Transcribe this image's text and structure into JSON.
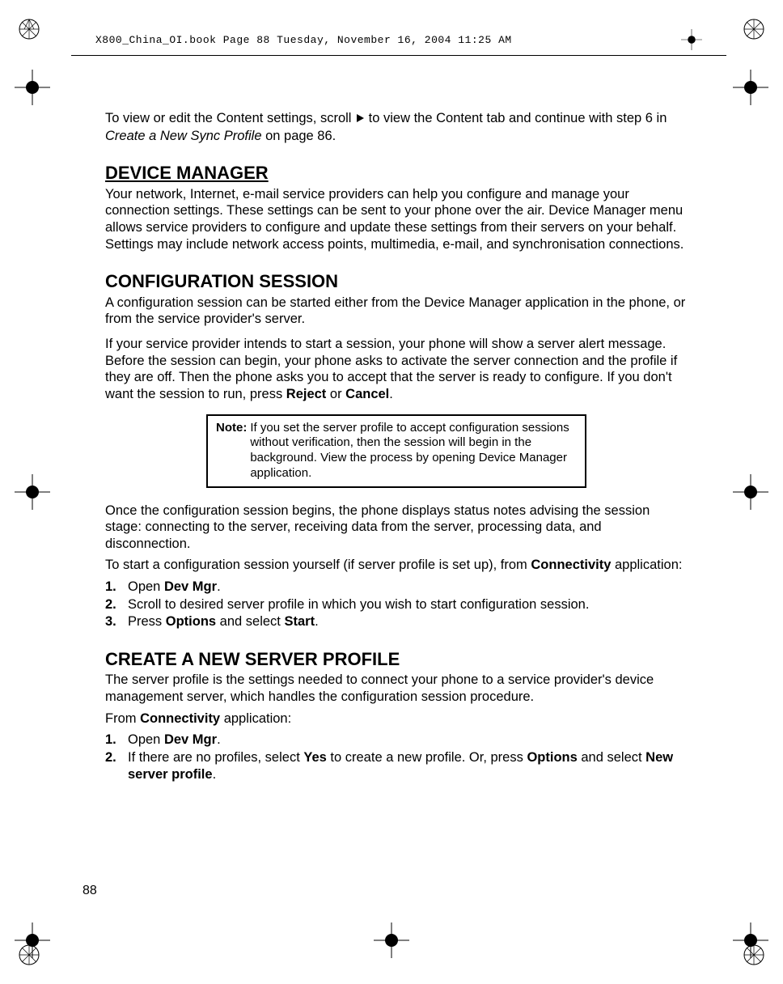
{
  "header": {
    "text": "X800_China_OI.book  Page 88  Tuesday, November 16, 2004  11:25 AM"
  },
  "intro": {
    "p1a": "To view or edit the Content settings, scroll ",
    "p1b": " to view the Content tab and continue with step 6 in ",
    "p1_italic": "Create a New Sync Profile",
    "p1c": " on page 86."
  },
  "device_manager": {
    "heading": "DEVICE MANAGER",
    "p1": "Your network, Internet, e-mail service providers can help you configure and manage your connection settings. These settings can be sent to your phone over the air. Device Manager menu allows service providers to configure and update these settings from their servers on your behalf. Settings may include network access points, multimedia, e-mail, and synchronisation connections."
  },
  "config_session": {
    "heading": "CONFIGURATION SESSION",
    "p1": "A configuration session can be started either from the Device Manager application in the phone, or from the service provider's server.",
    "p2a": "If your service provider intends to start a session, your phone will show a server alert message. Before the session can begin, your phone asks to activate the server connection and the profile if they are off. Then the phone asks you to accept that the server is ready to configure. If you don't want the session to run, press ",
    "p2_b1": "Reject",
    "p2b": " or ",
    "p2_b2": "Cancel",
    "p2c": ".",
    "note_label": "Note",
    "note_text": "If you set the server profile to accept configuration sessions without verification, then the session will begin in the background. View the process by opening Device Manager application.",
    "p3": "Once the configuration session begins, the phone displays status notes advising the session stage: connecting to the server, receiving data from the server, processing data, and disconnection.",
    "p4a": "To start a configuration session yourself (if server profile is set up), from ",
    "p4_b1": "Connectivity",
    "p4b": " application:",
    "steps": [
      {
        "num": "1.",
        "a": "Open ",
        "b1": "Dev Mgr",
        "c": "."
      },
      {
        "num": "2.",
        "a": "Scroll to desired server profile in which you wish to start configuration session.",
        "b1": "",
        "c": ""
      },
      {
        "num": "3.",
        "a": "Press ",
        "b1": "Options",
        "c": " and select ",
        "b2": "Start",
        "d": "."
      }
    ]
  },
  "server_profile": {
    "heading": "CREATE A NEW SERVER PROFILE",
    "p1": "The server profile is the settings needed to connect your phone to a service provider's device management server, which handles the configuration session procedure.",
    "p2a": "From ",
    "p2_b1": "Connectivity",
    "p2b": " application:",
    "steps": [
      {
        "num": "1.",
        "a": "Open ",
        "b1": "Dev Mgr",
        "c": "."
      },
      {
        "num": "2.",
        "a": "If there are no profiles, select ",
        "b1": "Yes",
        "c": " to create a new profile. Or, press ",
        "b2": "Options",
        "d": " and select ",
        "b3": "New server profile",
        "e": "."
      }
    ]
  },
  "page_number": "88"
}
